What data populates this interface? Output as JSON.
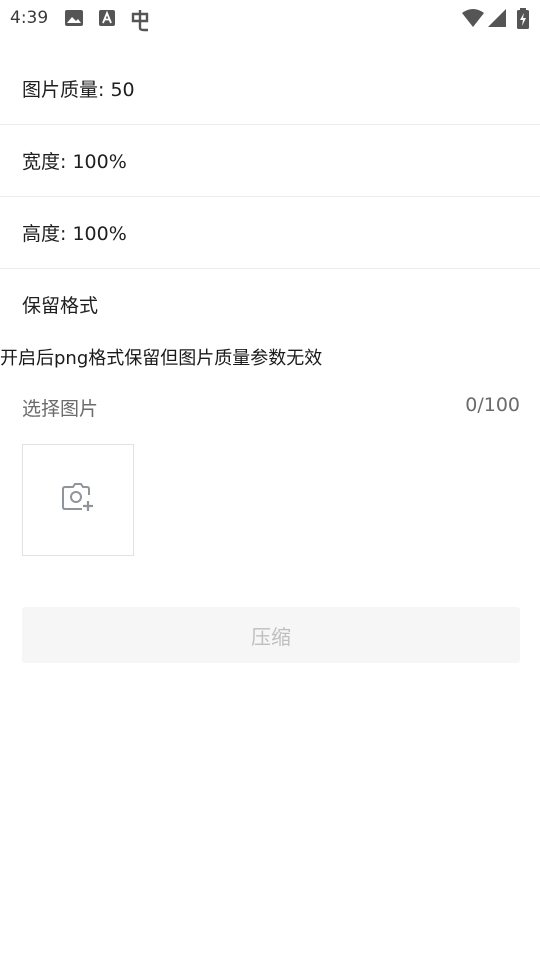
{
  "status_bar": {
    "time": "4:39",
    "icons": [
      "image-icon",
      "a-icon",
      "bug-icon",
      "wifi-icon",
      "signal-icon",
      "battery-icon"
    ]
  },
  "settings": {
    "quality_label": "图片质量: 50",
    "width_label": "宽度: 100%",
    "height_label": "高度: 100%",
    "keep_format_label": "保留格式"
  },
  "hint": "开启后png格式保留但图片质量参数无效",
  "picker": {
    "label": "选择图片",
    "count": "0/100"
  },
  "compress_button": "压缩",
  "colors": {
    "divider": "#ececec",
    "button_bg": "#f6f6f6",
    "button_text": "#bfbfbf",
    "muted_text": "#6b6b6b"
  }
}
